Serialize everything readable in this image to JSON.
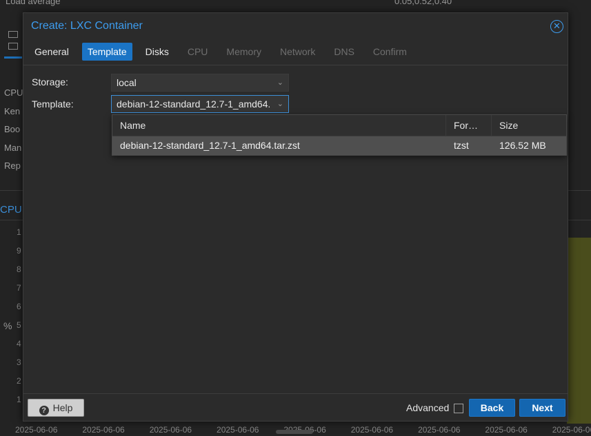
{
  "background": {
    "top_label": "Load average",
    "top_value": "0.05,0.52,0.40",
    "left_items": [
      "CPU",
      "Ken",
      "Boo",
      "Man",
      "Rep"
    ],
    "cpu_heading": "CPU",
    "y_ticks": [
      "1",
      "9",
      "8",
      "7",
      "6",
      "5",
      "4",
      "3",
      "2",
      "1"
    ],
    "y_unit": "%",
    "x_ticks": [
      "2025-06-06",
      "2025-06-06",
      "2025-06-06",
      "2025-06-06",
      "2025-06-06",
      "2025-06-06",
      "2025-06-06",
      "2025-06-06",
      "2025-06-06"
    ]
  },
  "dialog": {
    "title": "Create: LXC Container",
    "close_glyph": "✕",
    "tabs": [
      {
        "label": "General",
        "state": "enabled"
      },
      {
        "label": "Template",
        "state": "active"
      },
      {
        "label": "Disks",
        "state": "enabled"
      },
      {
        "label": "CPU",
        "state": "disabled"
      },
      {
        "label": "Memory",
        "state": "disabled"
      },
      {
        "label": "Network",
        "state": "disabled"
      },
      {
        "label": "DNS",
        "state": "disabled"
      },
      {
        "label": "Confirm",
        "state": "disabled"
      }
    ],
    "storage": {
      "label": "Storage:",
      "value": "local"
    },
    "template": {
      "label": "Template:",
      "value": "debian-12-standard_12.7-1_amd64.tar.zst"
    },
    "grid": {
      "columns": [
        "Name",
        "For…",
        "Size"
      ],
      "rows": [
        {
          "name": "debian-12-standard_12.7-1_amd64.tar.zst",
          "format": "tzst",
          "size": "126.52 MB"
        }
      ]
    },
    "footer": {
      "help": "Help",
      "advanced": "Advanced",
      "advanced_checked": false,
      "back": "Back",
      "next": "Next"
    }
  },
  "colors": {
    "accent": "#1b74c5",
    "title": "#3d9df0",
    "dialog_bg": "#2b2b2b",
    "selected_row": "#4f4f4f"
  }
}
